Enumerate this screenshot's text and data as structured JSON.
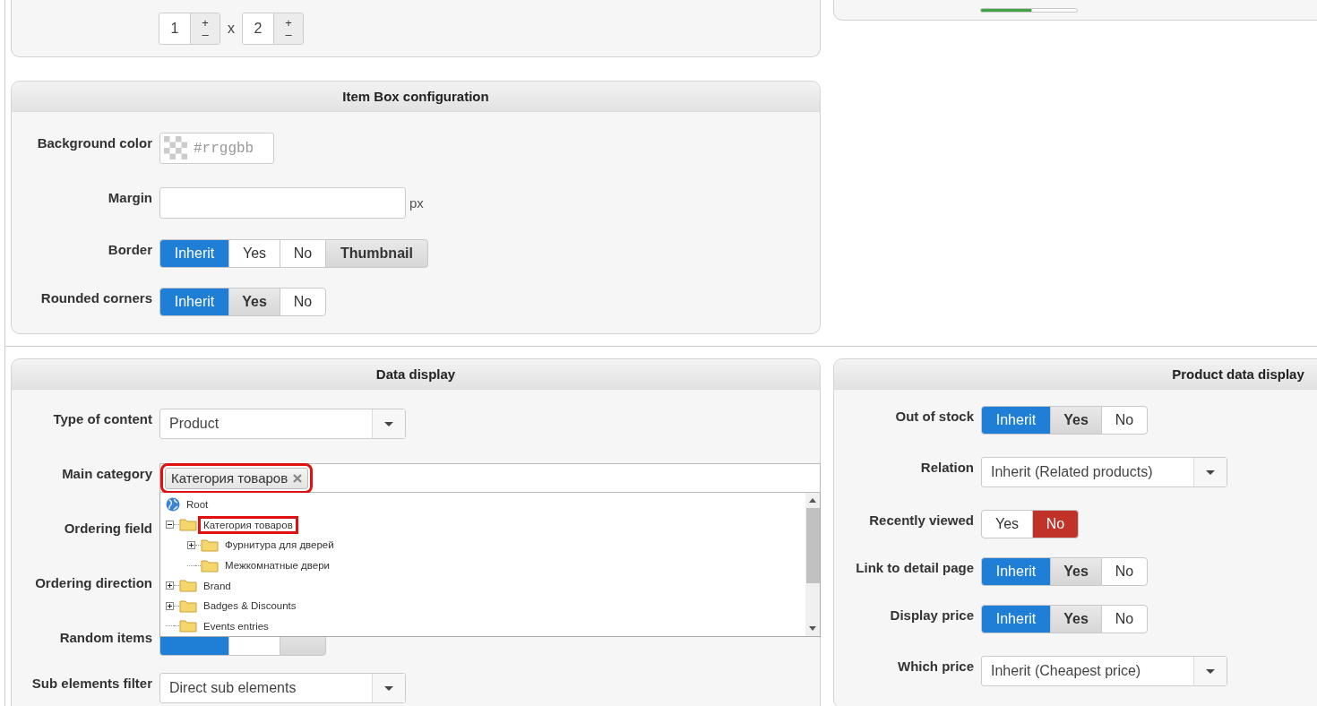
{
  "top_left_panel": {
    "grid": {
      "rows": "1",
      "cols": "2",
      "separator": "x",
      "increment": "+",
      "decrement": "–"
    }
  },
  "top_right_panel": {
    "toggle": [
      {
        "kind": "yes",
        "selected": true
      },
      {
        "kind": "no",
        "selected": false
      }
    ]
  },
  "item_box_panel": {
    "title": "Item Box configuration",
    "fields": [
      {
        "kind": "color",
        "label": "Background color",
        "placeholder": "#rrggbb"
      },
      {
        "kind": "text",
        "label": "Margin",
        "unit": "px"
      },
      {
        "kind": "toggle",
        "label": "Border",
        "options": [
          {
            "kind": "inherit",
            "label": "Inherit",
            "selected": true,
            "inherited": false
          },
          {
            "kind": "yes",
            "label": "Yes",
            "selected": false,
            "inherited": false
          },
          {
            "kind": "no",
            "label": "No",
            "selected": false,
            "inherited": false
          },
          {
            "kind": "thumbnail",
            "label": "Thumbnail",
            "selected": false,
            "inherited": true
          }
        ]
      },
      {
        "kind": "toggle",
        "label": "Rounded corners",
        "options": [
          {
            "kind": "inherit",
            "label": "Inherit",
            "selected": true,
            "inherited": false
          },
          {
            "kind": "yes",
            "label": "Yes",
            "selected": false,
            "inherited": true
          },
          {
            "kind": "no",
            "label": "No",
            "selected": false,
            "inherited": false
          }
        ]
      }
    ]
  },
  "data_display_panel": {
    "title": "Data display",
    "fields": [
      {
        "kind": "select",
        "label": "Type of content",
        "value": "Product"
      },
      {
        "kind": "tags",
        "label": "Main category",
        "tags": [
          {
            "label": "Категория товаров",
            "highlighted": true
          }
        ],
        "tree": [
          {
            "kind": "root",
            "label": "Root",
            "highlighted": false,
            "children": [
              {
                "kind": "folder",
                "label": "Категория товаров",
                "expanded": true,
                "highlighted": true,
                "children": [
                  {
                    "kind": "folder",
                    "label": "Фурнитура для дверей",
                    "expanded": false,
                    "highlighted": false
                  },
                  {
                    "kind": "folder",
                    "label": "Межкомнатные двери",
                    "highlighted": false
                  }
                ]
              },
              {
                "kind": "folder",
                "label": "Brand",
                "expanded": false,
                "highlighted": false
              },
              {
                "kind": "folder",
                "label": "Badges & Discounts",
                "expanded": false,
                "highlighted": false
              },
              {
                "kind": "folder",
                "label": "Events entries",
                "highlighted": false
              }
            ]
          }
        ]
      },
      {
        "kind": "covered",
        "label": "Ordering field"
      },
      {
        "kind": "covered",
        "label": "Ordering direction"
      },
      {
        "kind": "toggle",
        "label": "Random items",
        "options": [
          {
            "kind": "inherit",
            "selected": true,
            "inherited": false
          },
          {
            "kind": "yes",
            "selected": false,
            "inherited": false
          },
          {
            "kind": "no",
            "selected": false,
            "inherited": true
          }
        ]
      },
      {
        "kind": "select",
        "label": "Sub elements filter",
        "value": "Direct sub elements"
      }
    ]
  },
  "product_data_panel": {
    "title": "Product data display",
    "fields": [
      {
        "kind": "toggle",
        "label": "Out of stock",
        "options": [
          {
            "kind": "inherit",
            "label": "Inherit",
            "selected": true,
            "inherited": false
          },
          {
            "kind": "yes",
            "label": "Yes",
            "selected": false,
            "inherited": true
          },
          {
            "kind": "no",
            "label": "No",
            "selected": false,
            "inherited": false
          }
        ]
      },
      {
        "kind": "select",
        "label": "Relation",
        "value": "Inherit (Related products)"
      },
      {
        "kind": "toggle",
        "label": "Recently viewed",
        "options": [
          {
            "kind": "yes",
            "label": "Yes",
            "selected": false,
            "inherited": false
          },
          {
            "kind": "no",
            "label": "No",
            "selected": true,
            "inherited": false
          }
        ]
      },
      {
        "kind": "toggle",
        "label": "Link to detail page",
        "options": [
          {
            "kind": "inherit",
            "label": "Inherit",
            "selected": true,
            "inherited": false
          },
          {
            "kind": "yes",
            "label": "Yes",
            "selected": false,
            "inherited": true
          },
          {
            "kind": "no",
            "label": "No",
            "selected": false,
            "inherited": false
          }
        ]
      },
      {
        "kind": "toggle",
        "label": "Display price",
        "options": [
          {
            "kind": "inherit",
            "label": "Inherit",
            "selected": true,
            "inherited": false
          },
          {
            "kind": "yes",
            "label": "Yes",
            "selected": false,
            "inherited": true
          },
          {
            "kind": "no",
            "label": "No",
            "selected": false,
            "inherited": false
          }
        ]
      },
      {
        "kind": "select",
        "label": "Which price",
        "value": "Inherit (Cheapest price)"
      }
    ]
  }
}
